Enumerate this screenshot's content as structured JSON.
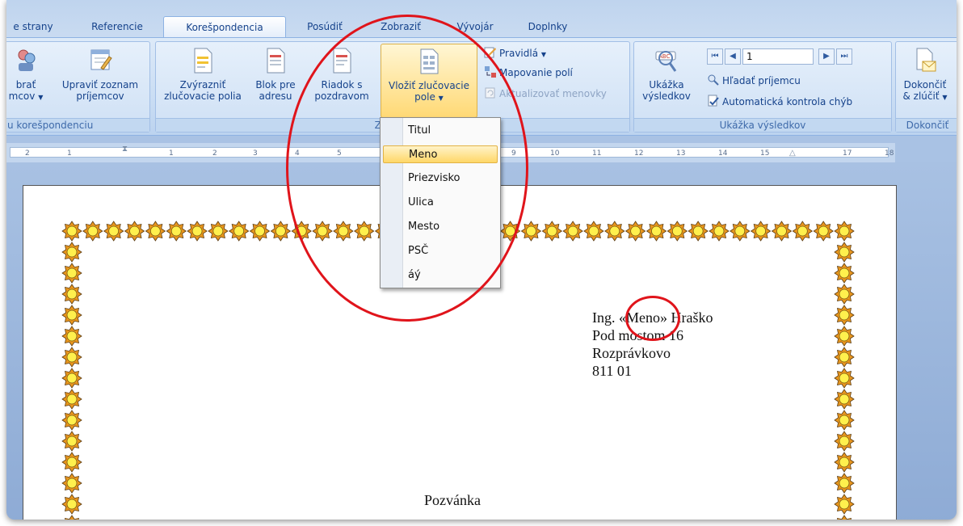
{
  "tabs": [
    {
      "label": "e strany"
    },
    {
      "label": "Referencie"
    },
    {
      "label": "Korešpondencia"
    },
    {
      "label": "Posúdiť"
    },
    {
      "label": "Zobraziť"
    },
    {
      "label": "Vývojár"
    },
    {
      "label": "Doplnky"
    }
  ],
  "ribbon": {
    "group1": {
      "label": "u korešpondenciu",
      "btn_select_line1": "brať",
      "btn_select_line2": "mcov",
      "btn_edit_line1": "Upraviť zoznam",
      "btn_edit_line2": "príjemcov"
    },
    "group2": {
      "label": "Zapísat",
      "btn_highlight_line1": "Zvýrazniť",
      "btn_highlight_line2": "zlučovacie polia",
      "btn_block_line1": "Blok pre",
      "btn_block_line2": "adresu",
      "btn_greeting_line1": "Riadok s",
      "btn_greeting_line2": "pozdravom",
      "btn_insert_line1": "Vložiť zlučovacie",
      "btn_insert_line2": "pole",
      "rules": "Pravidlá",
      "match_fields": "Mapovanie polí",
      "update_labels": "Aktualizovať menovky"
    },
    "group3": {
      "label": "Ukážka výsledkov",
      "preview_line1": "Ukážka",
      "preview_line2": "výsledkov",
      "record_value": "1",
      "find_recipient": "Hľadať príjemcu",
      "auto_check": "Automatická kontrola chýb"
    },
    "group4": {
      "label": "Dokončiť",
      "finish_line1": "Dokončiť",
      "finish_line2": "& zlúčiť"
    }
  },
  "ruler": {
    "ticks": [
      "2",
      "1",
      "1",
      "2",
      "3",
      "4",
      "5",
      "9",
      "10",
      "11",
      "12",
      "13",
      "14",
      "15",
      "17",
      "18"
    ]
  },
  "menu": {
    "items": [
      {
        "label": "Titul"
      },
      {
        "label": "Meno"
      },
      {
        "label": "Priezvisko"
      },
      {
        "label": "Ulica"
      },
      {
        "label": "Mesto"
      },
      {
        "label": "PSČ"
      },
      {
        "label": "áý"
      }
    ],
    "highlighted_index": 1
  },
  "document": {
    "address_line1": "Ing. «Meno» Hraško",
    "address_line2": "Pod mostom 16",
    "address_line3": "Rozprávkovo",
    "address_line4": "811 01",
    "heading": "Pozvánka"
  },
  "colors": {
    "annotation": "#e0141b",
    "border_sun_outer": "#e8961e",
    "border_sun_inner": "#fff04d"
  }
}
